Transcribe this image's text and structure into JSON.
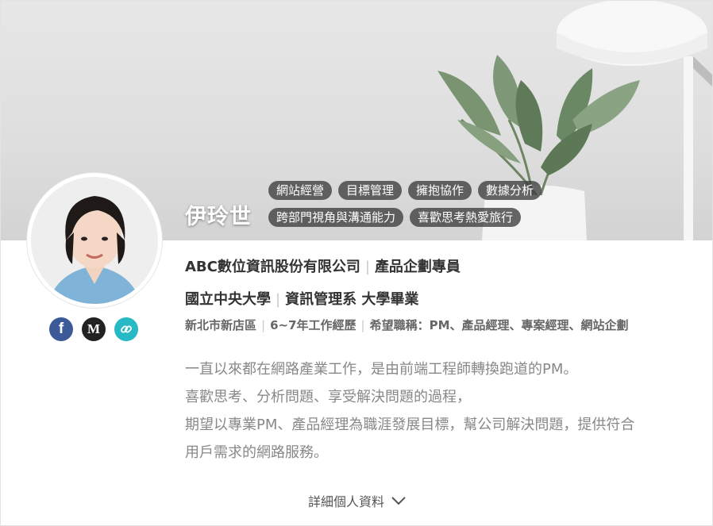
{
  "profile": {
    "name": "伊玲世",
    "tags_row1": [
      "網站經營",
      "目標管理",
      "擁抱協作",
      "數據分析"
    ],
    "tags_row2": [
      "跨部門視角與溝通能力",
      "喜歡思考熱愛旅行"
    ],
    "company": "ABC數位資訊股份有限公司",
    "title": "產品企劃專員",
    "school": "國立中央大學",
    "department": "資訊管理系 大學畢業",
    "location": "新北市新店區",
    "experience": "6~7年工作經歷",
    "desired_jobs": "希望職稱：PM、產品經理、專案經理、網站企劃",
    "intro_lines": [
      "一直以來都在網路產業工作，是由前端工程師轉換跑道的PM。",
      "喜歡思考、分析問題、享受解決問題的過程，",
      "期望以專業PM、產品經理為職涯發展目標，幫公司解決問題，提供符合",
      "用戶需求的網路服務。"
    ]
  },
  "socials": {
    "facebook_label": "f",
    "medium_label": "M",
    "icons": [
      "facebook-icon",
      "medium-icon",
      "link-icon"
    ],
    "colors": {
      "facebook": "#3d5a98",
      "medium": "#222222",
      "link": "#27b9c4"
    }
  },
  "more_link": {
    "label": "詳細個人資料",
    "icon": "chevron-down-icon"
  }
}
